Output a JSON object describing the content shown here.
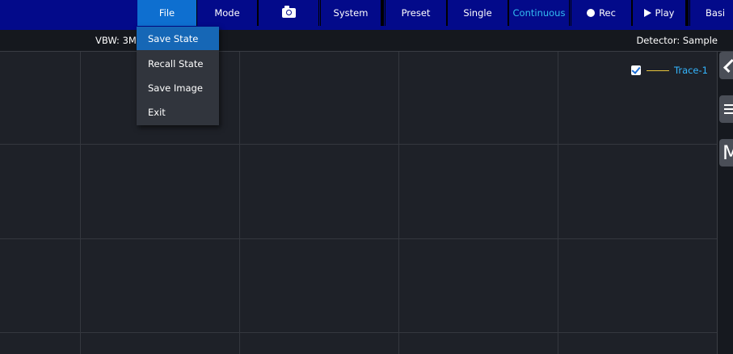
{
  "toolbar": {
    "buttons": {
      "file": "File",
      "mode": "Mode",
      "camera_icon": "camera-icon",
      "system": "System",
      "preset": "Preset",
      "single": "Single",
      "continuous": "Continuous",
      "rec": "Rec",
      "play": "Play",
      "basic": "Basi"
    },
    "active_tab": "File"
  },
  "infobar": {
    "vbw": "VBW: 3MH",
    "detector": "Detector: Sample"
  },
  "file_menu": {
    "items": [
      "Save State",
      "Recall State",
      "Save Image",
      "Exit"
    ],
    "selected": "Save State"
  },
  "legend": {
    "checked": true,
    "trace_label": "Trace-1",
    "trace_color": "#e6c43c",
    "label_color": "#34b6ff"
  },
  "right_panel": {
    "list_icon": "list-icon",
    "chevron_icon": "chevron-left-icon",
    "marker_letter": "M"
  },
  "colors": {
    "toolbar_bg": "#030a8a",
    "active_tab": "#0e6fd0",
    "menu_selected": "#1667b6",
    "plot_bg": "#1e2128",
    "grid": "#34373e"
  }
}
